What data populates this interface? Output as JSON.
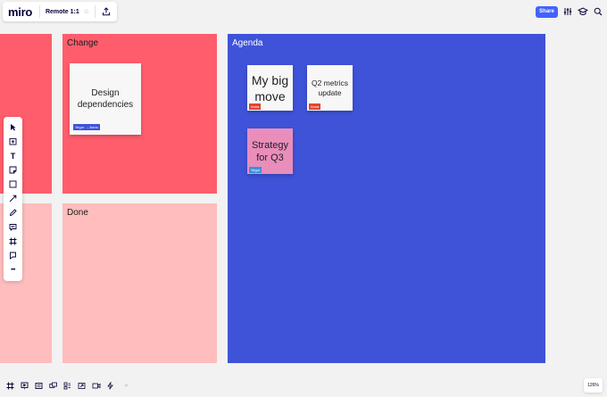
{
  "app": {
    "logo": "miro",
    "board_title": "Remote 1:1",
    "star_glyph": "☆"
  },
  "header": {
    "share_label": "Share"
  },
  "colors": {
    "frame_red": "#ff5d6c",
    "frame_pink": "#ffbdbd",
    "frame_blue": "#3f53d9",
    "sticky_white": "#f8f7f7",
    "sticky_pink": "#e98ebb",
    "accent": "#4262ff"
  },
  "frames": {
    "change": {
      "label": "Change"
    },
    "done": {
      "label": "Done"
    },
    "agenda": {
      "label": "Agenda"
    }
  },
  "stickies": {
    "design": {
      "text": "Design dependencies",
      "tag": "Yegor → Anna"
    },
    "big_move": {
      "text": "My big move",
      "tag": "Anna"
    },
    "q2": {
      "text": "Q2 metrics update",
      "tag": "Anna"
    },
    "strategy": {
      "text": "Strategy for Q3",
      "tag": "Yegor"
    }
  },
  "toolbar": {
    "tools": [
      "select-icon",
      "template-icon",
      "text-icon",
      "sticky-note-icon",
      "shape-icon",
      "connector-icon",
      "pen-icon",
      "comment-icon",
      "frame-icon",
      "card-icon",
      "more-icon"
    ],
    "text_tool_glyph": "T",
    "more_glyph": "•••"
  },
  "bottombar": {
    "icons": [
      "frames-icon",
      "present-icon",
      "comment-list-icon",
      "screens-icon",
      "kanban-icon",
      "share-screen-icon",
      "video-icon",
      "lightning-icon",
      "collapse-icon"
    ],
    "collapse_glyph": "»"
  },
  "zoom": {
    "level": "126%"
  }
}
